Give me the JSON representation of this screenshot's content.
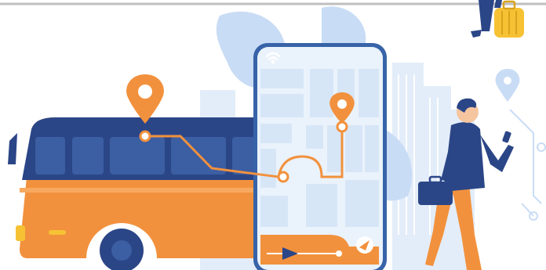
{
  "scene": {
    "subject": "bus-travel-navigation-illustration",
    "colors": {
      "accent_orange": "#f2913d",
      "bus_dark": "#2b4687",
      "phone_bg": "#eaf2fb",
      "phone_blocks": "#d7e6f7",
      "phone_frame": "#3763a8",
      "leaf_blue": "#c9dcf5",
      "building_blue": "#cfe0f6",
      "person_blue": "#2b4687",
      "person_orange": "#f2913d",
      "suitcase_yellow": "#f6c234",
      "route_line": "#f2913d"
    },
    "icons": [
      "map-pin-icon",
      "wifi-icon",
      "navigation-arrow-icon",
      "play-icon",
      "briefcase-icon",
      "suitcase-icon",
      "smartphone-icon"
    ]
  }
}
